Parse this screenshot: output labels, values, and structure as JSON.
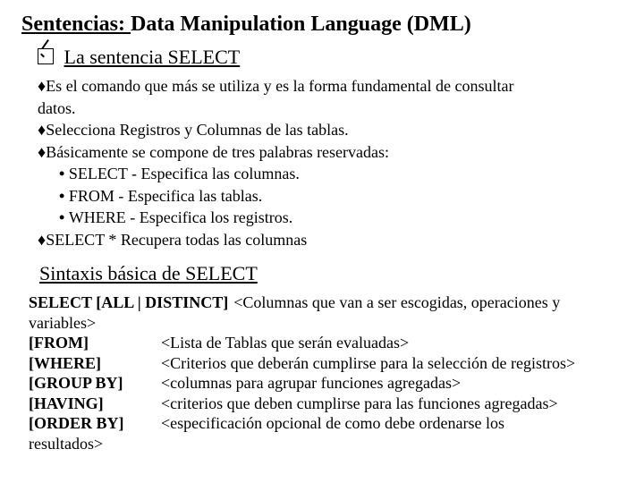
{
  "title": {
    "underlined": "Sentencias: ",
    "rest": "Data Manipulation Language (DML)"
  },
  "subhead": "La sentencia SELECT",
  "bullets": {
    "b1a": "Es el comando que más se utiliza y es la forma fundamental de consultar",
    "b1b": "datos.",
    "b2": "Selecciona Registros y Columnas de las tablas.",
    "b3": "Básicamente se compone de tres palabras reservadas:",
    "s1": "SELECT - Especifica las columnas.",
    "s2": "FROM    - Especifica las tablas.",
    "s3": "WHERE - Especifica los registros.",
    "b4": "SELECT * Recupera todas las columnas"
  },
  "section2": "Sintaxis básica de SELECT",
  "syntax": {
    "line1_kw": "SELECT [ALL | DISTINCT]",
    "line1_rest": " <Columnas que van a ser escogidas, operaciones y",
    "line1_cont": "variables>",
    "rows": [
      {
        "kw": "[FROM]",
        "desc": "<Lista de Tablas que serán evaluadas>"
      },
      {
        "kw": "[WHERE]",
        "desc": "<Criterios que deberán cumplirse para la selección de registros>"
      },
      {
        "kw": "[GROUP BY]",
        "desc": "<columnas para agrupar funciones agregadas>"
      },
      {
        "kw": "[HAVING]",
        "desc": "<criterios que deben cumplirse para las funciones agregadas>"
      },
      {
        "kw": "[ORDER BY]",
        "desc": "<especificación opcional de como debe ordenarse los"
      }
    ],
    "trailing": "resultados>"
  }
}
